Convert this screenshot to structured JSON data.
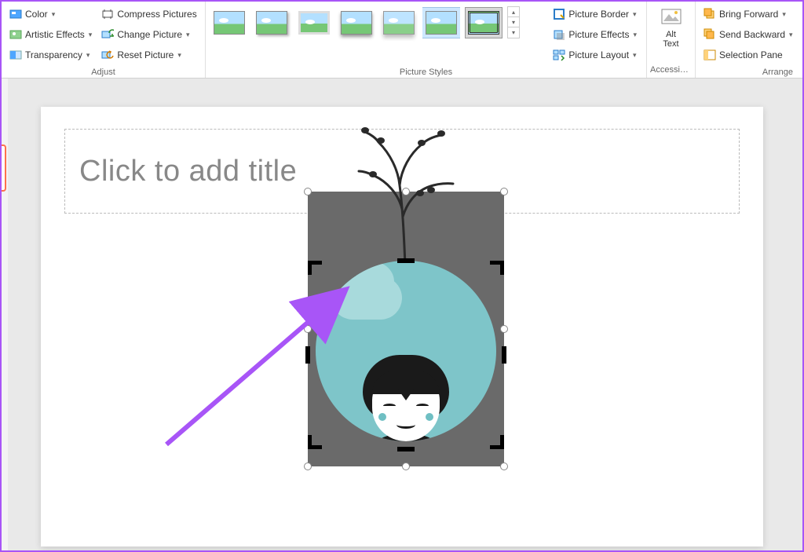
{
  "ribbon": {
    "adjust": {
      "label": "Adjust",
      "color": "Color",
      "artistic": "Artistic Effects",
      "transparency": "Transparency",
      "compress": "Compress Pictures",
      "change": "Change Picture",
      "reset": "Reset Picture"
    },
    "styles": {
      "label": "Picture Styles"
    },
    "picture": {
      "border": "Picture Border",
      "effects": "Picture Effects",
      "layout": "Picture Layout"
    },
    "accessibility": {
      "alt_text": "Alt\nText",
      "label": "Accessibili..."
    },
    "arrange": {
      "label": "Arrange",
      "bring_forward": "Bring Forward",
      "send_backward": "Send Backward",
      "selection_pane": "Selection Pane"
    }
  },
  "slide": {
    "title_placeholder": "Click to add title"
  }
}
